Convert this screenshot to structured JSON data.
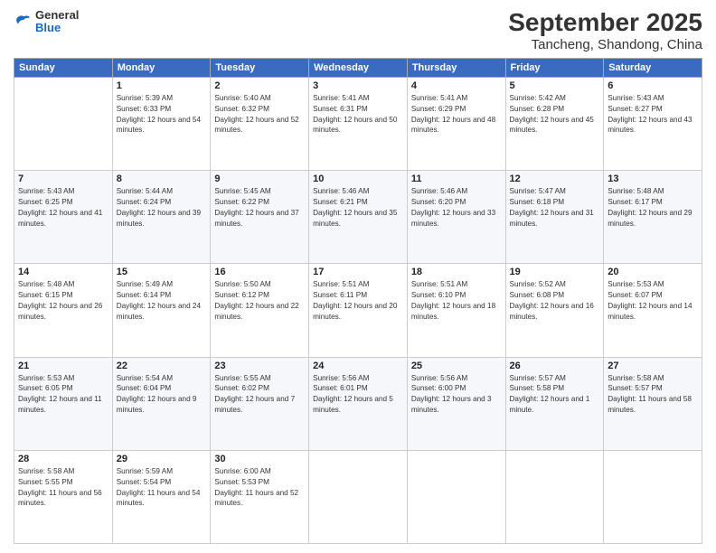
{
  "logo": {
    "general": "General",
    "blue": "Blue"
  },
  "title": "September 2025",
  "subtitle": "Tancheng, Shandong, China",
  "days_of_week": [
    "Sunday",
    "Monday",
    "Tuesday",
    "Wednesday",
    "Thursday",
    "Friday",
    "Saturday"
  ],
  "weeks": [
    [
      {
        "day": "",
        "sunrise": "",
        "sunset": "",
        "daylight": ""
      },
      {
        "day": "1",
        "sunrise": "Sunrise: 5:39 AM",
        "sunset": "Sunset: 6:33 PM",
        "daylight": "Daylight: 12 hours and 54 minutes."
      },
      {
        "day": "2",
        "sunrise": "Sunrise: 5:40 AM",
        "sunset": "Sunset: 6:32 PM",
        "daylight": "Daylight: 12 hours and 52 minutes."
      },
      {
        "day": "3",
        "sunrise": "Sunrise: 5:41 AM",
        "sunset": "Sunset: 6:31 PM",
        "daylight": "Daylight: 12 hours and 50 minutes."
      },
      {
        "day": "4",
        "sunrise": "Sunrise: 5:41 AM",
        "sunset": "Sunset: 6:29 PM",
        "daylight": "Daylight: 12 hours and 48 minutes."
      },
      {
        "day": "5",
        "sunrise": "Sunrise: 5:42 AM",
        "sunset": "Sunset: 6:28 PM",
        "daylight": "Daylight: 12 hours and 45 minutes."
      },
      {
        "day": "6",
        "sunrise": "Sunrise: 5:43 AM",
        "sunset": "Sunset: 6:27 PM",
        "daylight": "Daylight: 12 hours and 43 minutes."
      }
    ],
    [
      {
        "day": "7",
        "sunrise": "Sunrise: 5:43 AM",
        "sunset": "Sunset: 6:25 PM",
        "daylight": "Daylight: 12 hours and 41 minutes."
      },
      {
        "day": "8",
        "sunrise": "Sunrise: 5:44 AM",
        "sunset": "Sunset: 6:24 PM",
        "daylight": "Daylight: 12 hours and 39 minutes."
      },
      {
        "day": "9",
        "sunrise": "Sunrise: 5:45 AM",
        "sunset": "Sunset: 6:22 PM",
        "daylight": "Daylight: 12 hours and 37 minutes."
      },
      {
        "day": "10",
        "sunrise": "Sunrise: 5:46 AM",
        "sunset": "Sunset: 6:21 PM",
        "daylight": "Daylight: 12 hours and 35 minutes."
      },
      {
        "day": "11",
        "sunrise": "Sunrise: 5:46 AM",
        "sunset": "Sunset: 6:20 PM",
        "daylight": "Daylight: 12 hours and 33 minutes."
      },
      {
        "day": "12",
        "sunrise": "Sunrise: 5:47 AM",
        "sunset": "Sunset: 6:18 PM",
        "daylight": "Daylight: 12 hours and 31 minutes."
      },
      {
        "day": "13",
        "sunrise": "Sunrise: 5:48 AM",
        "sunset": "Sunset: 6:17 PM",
        "daylight": "Daylight: 12 hours and 29 minutes."
      }
    ],
    [
      {
        "day": "14",
        "sunrise": "Sunrise: 5:48 AM",
        "sunset": "Sunset: 6:15 PM",
        "daylight": "Daylight: 12 hours and 26 minutes."
      },
      {
        "day": "15",
        "sunrise": "Sunrise: 5:49 AM",
        "sunset": "Sunset: 6:14 PM",
        "daylight": "Daylight: 12 hours and 24 minutes."
      },
      {
        "day": "16",
        "sunrise": "Sunrise: 5:50 AM",
        "sunset": "Sunset: 6:12 PM",
        "daylight": "Daylight: 12 hours and 22 minutes."
      },
      {
        "day": "17",
        "sunrise": "Sunrise: 5:51 AM",
        "sunset": "Sunset: 6:11 PM",
        "daylight": "Daylight: 12 hours and 20 minutes."
      },
      {
        "day": "18",
        "sunrise": "Sunrise: 5:51 AM",
        "sunset": "Sunset: 6:10 PM",
        "daylight": "Daylight: 12 hours and 18 minutes."
      },
      {
        "day": "19",
        "sunrise": "Sunrise: 5:52 AM",
        "sunset": "Sunset: 6:08 PM",
        "daylight": "Daylight: 12 hours and 16 minutes."
      },
      {
        "day": "20",
        "sunrise": "Sunrise: 5:53 AM",
        "sunset": "Sunset: 6:07 PM",
        "daylight": "Daylight: 12 hours and 14 minutes."
      }
    ],
    [
      {
        "day": "21",
        "sunrise": "Sunrise: 5:53 AM",
        "sunset": "Sunset: 6:05 PM",
        "daylight": "Daylight: 12 hours and 11 minutes."
      },
      {
        "day": "22",
        "sunrise": "Sunrise: 5:54 AM",
        "sunset": "Sunset: 6:04 PM",
        "daylight": "Daylight: 12 hours and 9 minutes."
      },
      {
        "day": "23",
        "sunrise": "Sunrise: 5:55 AM",
        "sunset": "Sunset: 6:02 PM",
        "daylight": "Daylight: 12 hours and 7 minutes."
      },
      {
        "day": "24",
        "sunrise": "Sunrise: 5:56 AM",
        "sunset": "Sunset: 6:01 PM",
        "daylight": "Daylight: 12 hours and 5 minutes."
      },
      {
        "day": "25",
        "sunrise": "Sunrise: 5:56 AM",
        "sunset": "Sunset: 6:00 PM",
        "daylight": "Daylight: 12 hours and 3 minutes."
      },
      {
        "day": "26",
        "sunrise": "Sunrise: 5:57 AM",
        "sunset": "Sunset: 5:58 PM",
        "daylight": "Daylight: 12 hours and 1 minute."
      },
      {
        "day": "27",
        "sunrise": "Sunrise: 5:58 AM",
        "sunset": "Sunset: 5:57 PM",
        "daylight": "Daylight: 11 hours and 58 minutes."
      }
    ],
    [
      {
        "day": "28",
        "sunrise": "Sunrise: 5:58 AM",
        "sunset": "Sunset: 5:55 PM",
        "daylight": "Daylight: 11 hours and 56 minutes."
      },
      {
        "day": "29",
        "sunrise": "Sunrise: 5:59 AM",
        "sunset": "Sunset: 5:54 PM",
        "daylight": "Daylight: 11 hours and 54 minutes."
      },
      {
        "day": "30",
        "sunrise": "Sunrise: 6:00 AM",
        "sunset": "Sunset: 5:53 PM",
        "daylight": "Daylight: 11 hours and 52 minutes."
      },
      {
        "day": "",
        "sunrise": "",
        "sunset": "",
        "daylight": ""
      },
      {
        "day": "",
        "sunrise": "",
        "sunset": "",
        "daylight": ""
      },
      {
        "day": "",
        "sunrise": "",
        "sunset": "",
        "daylight": ""
      },
      {
        "day": "",
        "sunrise": "",
        "sunset": "",
        "daylight": ""
      }
    ]
  ]
}
